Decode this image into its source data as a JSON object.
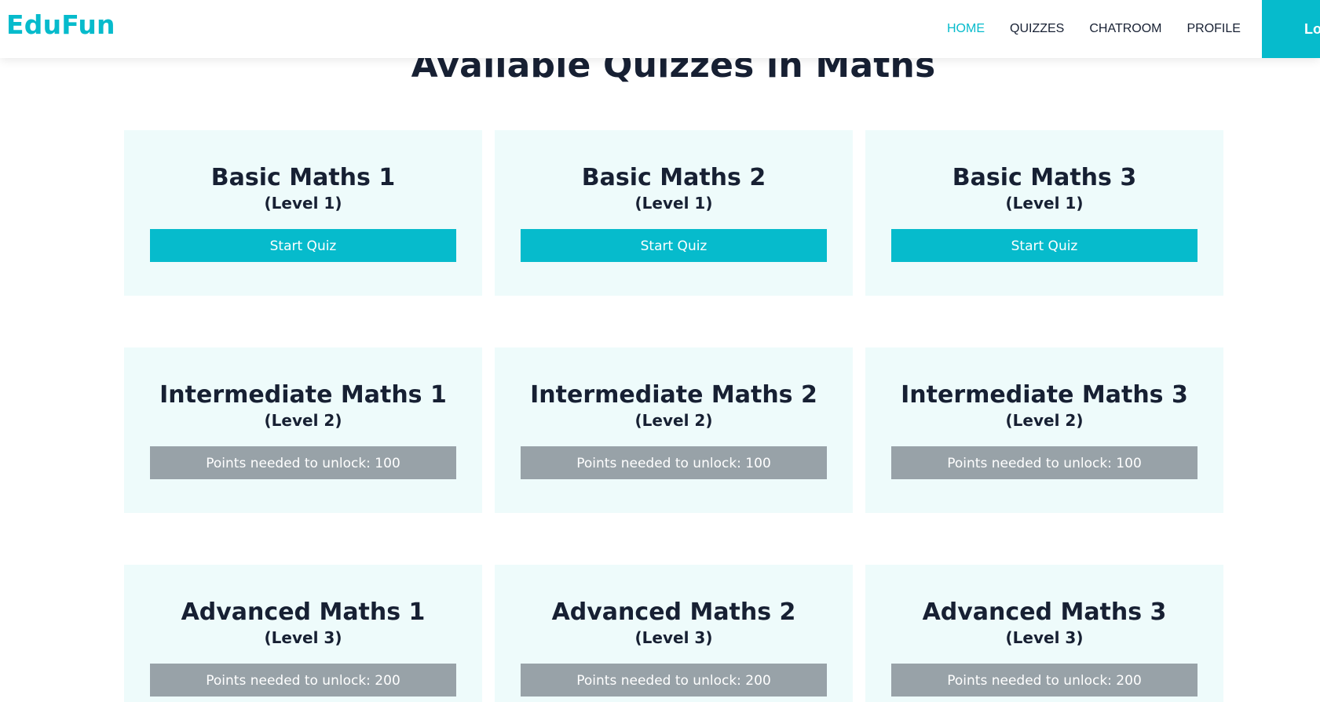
{
  "brand": "EduFun",
  "nav": {
    "items": [
      {
        "label": "HOME",
        "active": true
      },
      {
        "label": "QUIZZES",
        "active": false
      },
      {
        "label": "CHATROOM",
        "active": false
      },
      {
        "label": "PROFILE",
        "active": false
      }
    ],
    "login_label": "Lo"
  },
  "page_title": "Available Quizzes in Maths",
  "colors": {
    "accent": "#06bbcc",
    "locked": "#98a2a8",
    "card_background": "#eefbfb",
    "text": "#172033"
  },
  "quizzes": [
    {
      "title": "Basic Maths 1",
      "level": "(Level 1)",
      "button": "Start Quiz"
    },
    {
      "title": "Basic Maths 2",
      "level": "(Level 1)",
      "button": "Start Quiz"
    },
    {
      "title": "Basic Maths 3",
      "level": "(Level 1)",
      "button": "Start Quiz"
    },
    {
      "title": "Intermediate Maths 1",
      "level": "(Level 2)",
      "button": "Points needed to unlock: 100"
    },
    {
      "title": "Intermediate Maths 2",
      "level": "(Level 2)",
      "button": "Points needed to unlock: 100"
    },
    {
      "title": "Intermediate Maths 3",
      "level": "(Level 2)",
      "button": "Points needed to unlock: 100"
    },
    {
      "title": "Advanced Maths 1",
      "level": "(Level 3)",
      "button": "Points needed to unlock: 200"
    },
    {
      "title": "Advanced Maths 2",
      "level": "(Level 3)",
      "button": "Points needed to unlock: 200"
    },
    {
      "title": "Advanced Maths 3",
      "level": "(Level 3)",
      "button": "Points needed to unlock: 200"
    }
  ]
}
